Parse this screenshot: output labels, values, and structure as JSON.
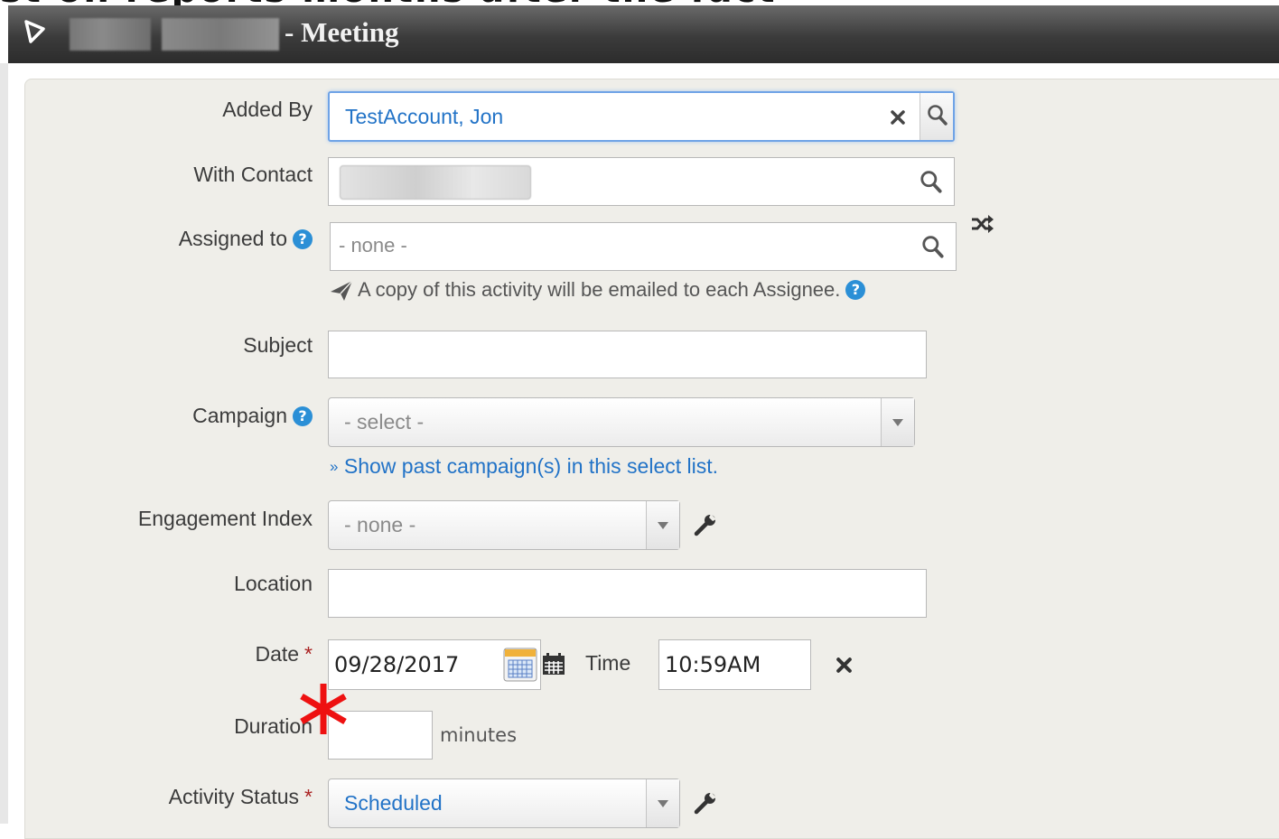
{
  "header": {
    "title": "- Meeting",
    "background_text": "st on reports months after the fact"
  },
  "form": {
    "added_by": {
      "label": "Added By",
      "value": "TestAccount, Jon"
    },
    "with_contact": {
      "label": "With Contact"
    },
    "assigned_to": {
      "label": "Assigned to",
      "placeholder": "- none -",
      "note": "A copy of this activity will be emailed to each Assignee."
    },
    "subject": {
      "label": "Subject",
      "value": ""
    },
    "campaign": {
      "label": "Campaign",
      "selected": "- select -",
      "link": "Show past campaign(s) in this select list."
    },
    "engagement_index": {
      "label": "Engagement Index",
      "selected": "- none -"
    },
    "location": {
      "label": "Location",
      "value": ""
    },
    "date": {
      "label": "Date",
      "value": "09/28/2017"
    },
    "time": {
      "label": "Time",
      "value": "10:59AM"
    },
    "duration": {
      "label": "Duration",
      "value": "",
      "unit": "minutes"
    },
    "activity_status": {
      "label": "Activity Status",
      "selected": "Scheduled"
    },
    "required_marker": "*",
    "link_prefix": "»"
  },
  "colors": {
    "accent_blue": "#2273c7",
    "help_icon": "#2b8fd6",
    "annotation_red": "#ee1111",
    "panel_bg": "#efeee9"
  },
  "icons": [
    "collapse-triangle-icon",
    "search-icon",
    "clear-icon",
    "help-icon",
    "shuffle-icon",
    "send-icon",
    "wrench-icon",
    "calendar-icon",
    "calendar-small-icon",
    "close-icon",
    "red-asterisk-annotation"
  ]
}
